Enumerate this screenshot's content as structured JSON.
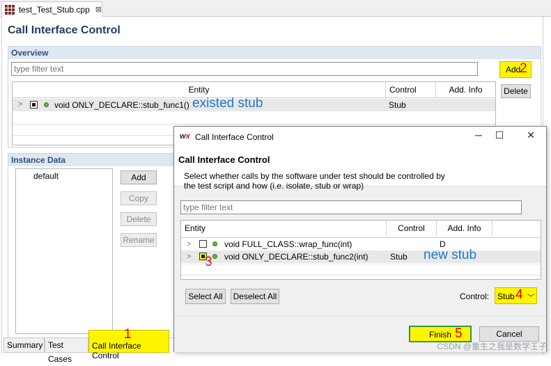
{
  "editor_tab": {
    "title": "test_Test_Stub.cpp",
    "close": "⊠"
  },
  "page": {
    "title": "Call Interface Control"
  },
  "overview": {
    "header": "Overview",
    "filter_placeholder": "type filter text",
    "columns": [
      "Entity",
      "Control",
      "Add. Info"
    ],
    "rows": [
      {
        "entity": "void ONLY_DECLARE::stub_func1()",
        "control": "Stub",
        "info": "",
        "annotation": "existed stub"
      }
    ],
    "add_button": "Add..",
    "add_marker": "2",
    "delete_button": "Delete"
  },
  "instance_data": {
    "header": "Instance Data",
    "items": [
      "default"
    ],
    "buttons": [
      "Add",
      "Copy",
      "Delete",
      "Rename"
    ]
  },
  "bottom_tabs": [
    "Summary",
    "Test Cases",
    "Call Interface Control"
  ],
  "bottom_tab_marker": "1",
  "dialog": {
    "window_title": "Call Interface Control",
    "logo_w": "w",
    "logo_x": "x",
    "minimize": "─",
    "maximize": "☐",
    "close": "✕",
    "heading": "Call Interface Control",
    "description_line1": "Select whether calls by the software under test should be controlled by",
    "description_line2": "the test script and how (i.e. isolate, stub or wrap)",
    "filter_placeholder": "type filter text",
    "columns": [
      "Entity",
      "Control",
      "Add. Info"
    ],
    "rows": [
      {
        "entity": "void FULL_CLASS::wrap_func(int)",
        "control": "",
        "info": "D"
      },
      {
        "entity": "void ONLY_DECLARE::stub_func2(int)",
        "control": "Stub",
        "info": "",
        "annotation": "new stub",
        "marker": "3"
      }
    ],
    "select_all": "Select All",
    "deselect_all": "Deselect All",
    "control_label": "Control:",
    "control_value": "Stub",
    "control_marker": "4",
    "finish": "Finish",
    "finish_marker": "5",
    "cancel": "Cancel"
  },
  "watermark": "CSDN @重生之我是数学王子"
}
